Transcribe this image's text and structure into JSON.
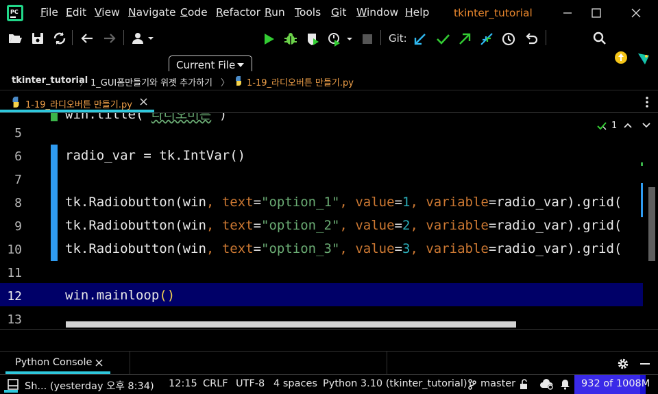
{
  "window": {
    "project_title": "tkinter_tutorial"
  },
  "menu": [
    {
      "label": "File",
      "underline": "F",
      "rest": "ile"
    },
    {
      "label": "Edit",
      "underline": "E",
      "rest": "dit"
    },
    {
      "label": "View",
      "underline": "V",
      "rest": "iew"
    },
    {
      "label": "Navigate",
      "underline": "N",
      "rest": "avigate"
    },
    {
      "label": "Code",
      "underline": "C",
      "rest": "ode"
    },
    {
      "label": "Refactor",
      "underline": "R",
      "rest": "efactor"
    },
    {
      "label": "Run",
      "underline": "R",
      "rest": "un"
    },
    {
      "label": "Tools",
      "underline": "T",
      "rest": "ools"
    },
    {
      "label": "Git",
      "underline": "G",
      "rest": "it"
    },
    {
      "label": "Window",
      "underline": "W",
      "rest": "indow"
    },
    {
      "label": "Help",
      "underline": "H",
      "rest": "elp"
    }
  ],
  "toolbar": {
    "run_config": "Current File",
    "git_label": "Git:"
  },
  "breadcrumb": [
    "tkinter_tutorial",
    "1_GUI폼만들기와 위젯 추가하기",
    "1-19_라디오버튼 만들기.py"
  ],
  "editor": {
    "tab_label": "1-19_라디오버튼 만들기.py",
    "inspection_count": "1",
    "lines": [
      {
        "num": "5",
        "code": ""
      },
      {
        "num": "6",
        "code": "radio_var = tk.IntVar()"
      },
      {
        "num": "7",
        "code": ""
      },
      {
        "num": "8",
        "code": "tk.Radiobutton(win, text=\"option_1\", value=1, variable=radio_var).grid("
      },
      {
        "num": "9",
        "code": "tk.Radiobutton(win, text=\"option_2\", value=2, variable=radio_var).grid("
      },
      {
        "num": "10",
        "code": "tk.Radiobutton(win, text=\"option_3\", value=3, variable=radio_var).grid("
      },
      {
        "num": "11",
        "code": ""
      },
      {
        "num": "12",
        "code": "win.mainloop()"
      },
      {
        "num": "13",
        "code": ""
      }
    ],
    "current_line": "12"
  },
  "tool_window": {
    "tab_label": "Python Console"
  },
  "status": {
    "vcs_message": "Sh... (yesterday 오후 8:34)",
    "caret": "12:15",
    "line_sep": "CRLF",
    "encoding": "UTF-8",
    "indent": "4 spaces",
    "interpreter": "Python 3.10 (tkinter_tutorial)",
    "branch": "master",
    "memory": "932 of 1008M",
    "memory_fraction": 0.92
  },
  "colors": {
    "accent_cyan": "#2fc8dc",
    "current_line_bg": "#000068",
    "gutter_change": "#2f9bf0",
    "keyword_arg": "#cc7832",
    "string": "#6aab73",
    "number": "#2aacb8",
    "title_orange": "#e8862c"
  }
}
